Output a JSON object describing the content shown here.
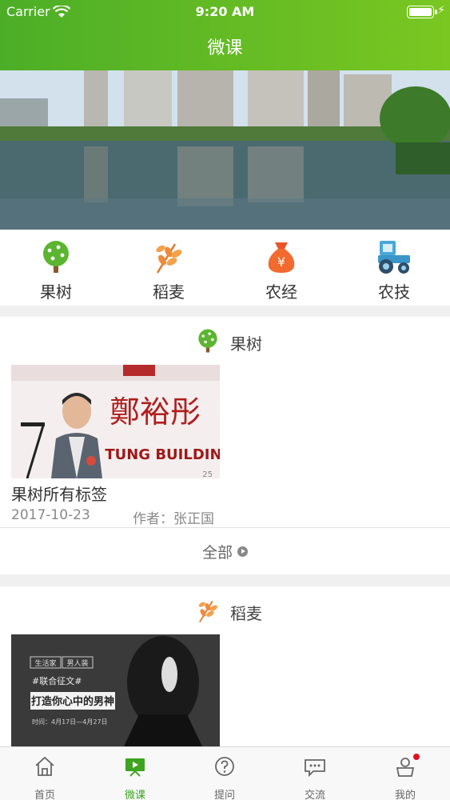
{
  "status": {
    "carrier": "Carrier",
    "time": "9:20 AM"
  },
  "header": {
    "title": "微课"
  },
  "banner": {
    "dot_count": 2,
    "active_dot": 1
  },
  "categories": [
    {
      "label": "果树",
      "icon": "fruit-tree-icon"
    },
    {
      "label": "稻麦",
      "icon": "wheat-icon"
    },
    {
      "label": "农经",
      "icon": "money-bag-icon"
    },
    {
      "label": "农技",
      "icon": "tractor-icon"
    }
  ],
  "sections": [
    {
      "title": "果树",
      "icon": "fruit-tree-icon",
      "item": {
        "title": "果树所有标签",
        "date": "2017-10-23",
        "author": "作者：张正国",
        "thumb_text_big": "鄭裕彤",
        "thumb_text_sub": "U TUNG BUILDIN",
        "thumb_text_num": "25"
      },
      "more_label": "全部"
    },
    {
      "title": "稻麦",
      "icon": "wheat-icon",
      "item": {
        "tag1": "生活家",
        "tag2": "男人装",
        "hashtag": "#联合征文#",
        "headline": "打造你心中的男神",
        "time_text": "时间：4月17日—4月27日"
      }
    }
  ],
  "tabbar": [
    {
      "label": "首页",
      "icon": "home-icon"
    },
    {
      "label": "微课",
      "icon": "video-lesson-icon",
      "active": true
    },
    {
      "label": "提问",
      "icon": "question-icon"
    },
    {
      "label": "交流",
      "icon": "chat-icon"
    },
    {
      "label": "我的",
      "icon": "profile-icon",
      "badge": true
    }
  ],
  "colors": {
    "brand_green": "#4cae27",
    "active_tab": "#3ea320",
    "badge_red": "#e01020"
  }
}
